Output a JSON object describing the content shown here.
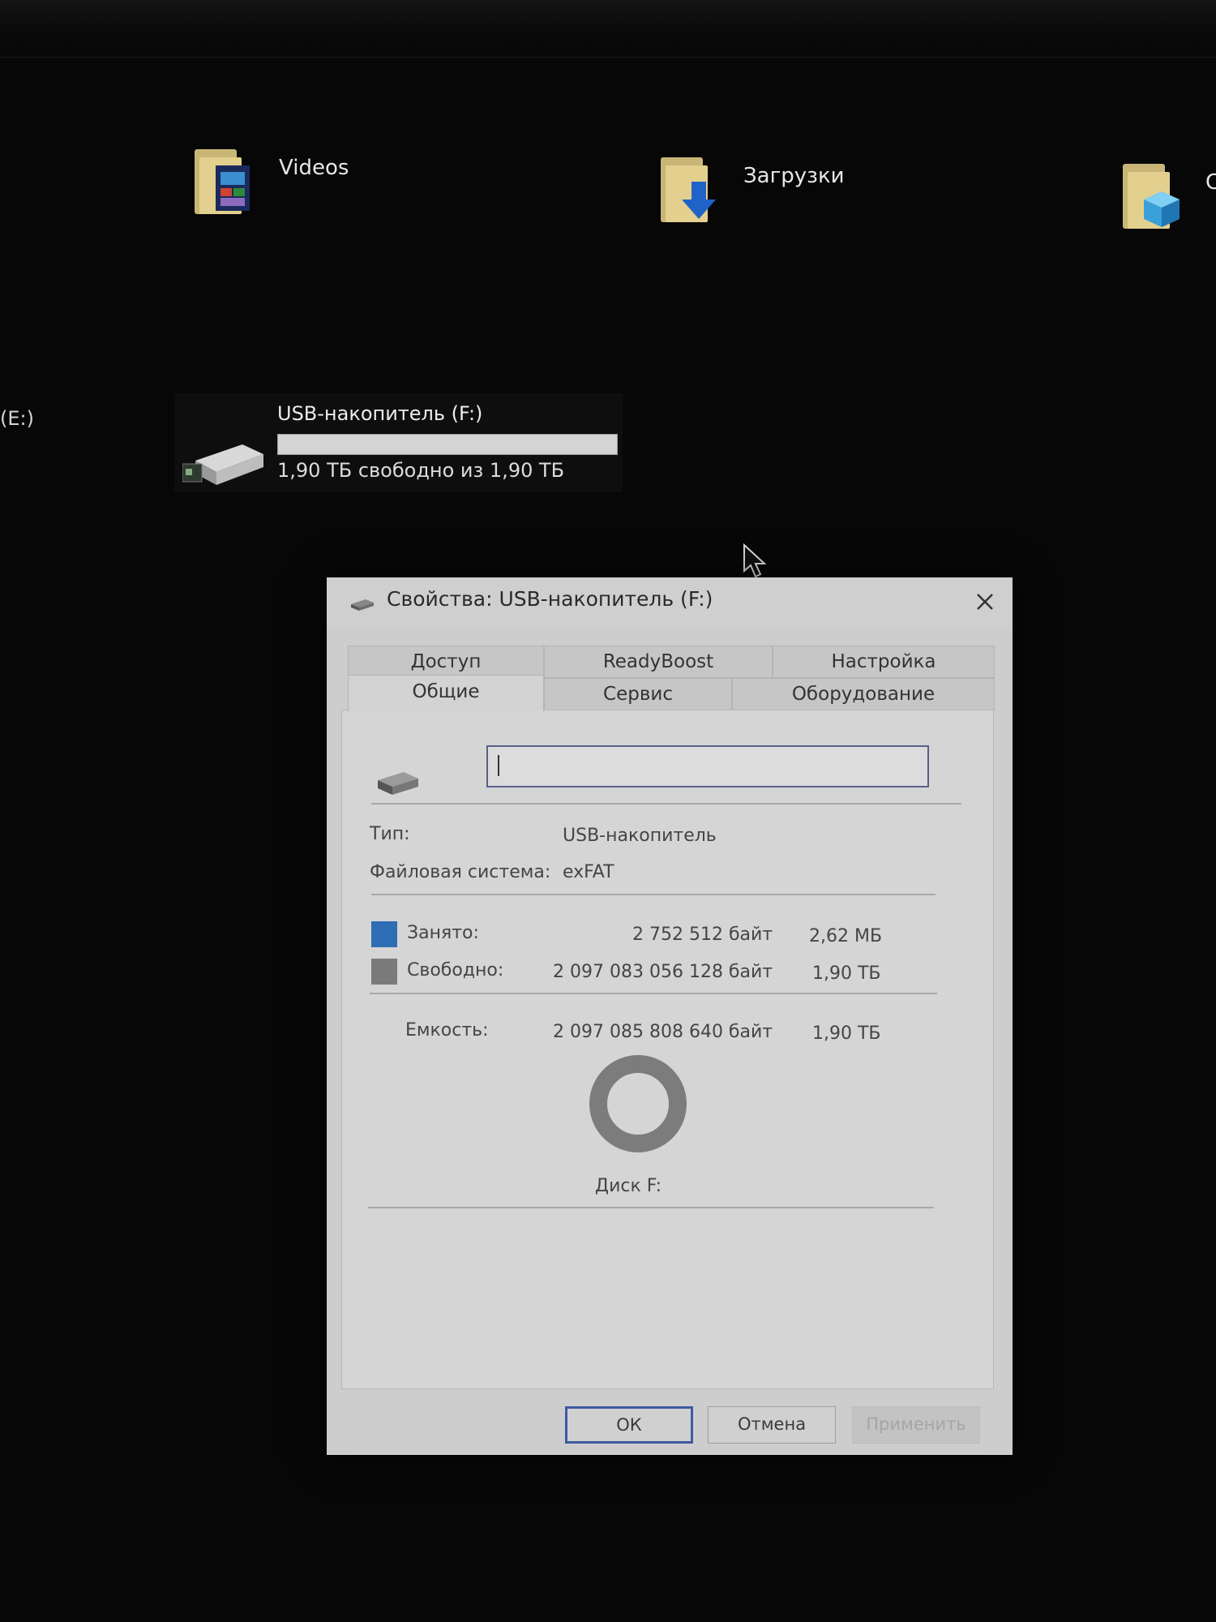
{
  "desktop": {
    "folders": [
      {
        "label": "Videos",
        "icon": "videos-folder-icon"
      },
      {
        "label": "Загрузки",
        "icon": "downloads-folder-icon"
      },
      {
        "label": "С",
        "icon": "3d-objects-folder-icon"
      }
    ],
    "left_drive_label": "(E:)",
    "drive": {
      "name": "USB-накопитель (F:)",
      "free_text": "1,90 ТБ свободно из 1,90 ТБ",
      "used_fraction": 0.0
    }
  },
  "dialog": {
    "title": "Свойства: USB-накопитель (F:)",
    "tabs_row1": [
      "Доступ",
      "ReadyBoost",
      "Настройка"
    ],
    "tabs_row2": [
      "Общие",
      "Сервис",
      "Оборудование"
    ],
    "active_tab": "Общие",
    "name_value": "",
    "type_label": "Тип:",
    "type_value": "USB-накопитель",
    "fs_label": "Файловая система:",
    "fs_value": "exFAT",
    "used": {
      "label": "Занято:",
      "bytes": "2 752 512 байт",
      "size": "2,62 МБ",
      "color": "#2e6db4"
    },
    "free": {
      "label": "Свободно:",
      "bytes": "2 097 083 056 128 байт",
      "size": "1,90 ТБ",
      "color": "#7a7a7a"
    },
    "capacity": {
      "label": "Емкость:",
      "bytes": "2 097 085 808 640 байт",
      "size": "1,90 ТБ"
    },
    "disk_label": "Диск F:",
    "buttons": {
      "ok": "ОК",
      "cancel": "Отмена",
      "apply": "Применить"
    }
  }
}
